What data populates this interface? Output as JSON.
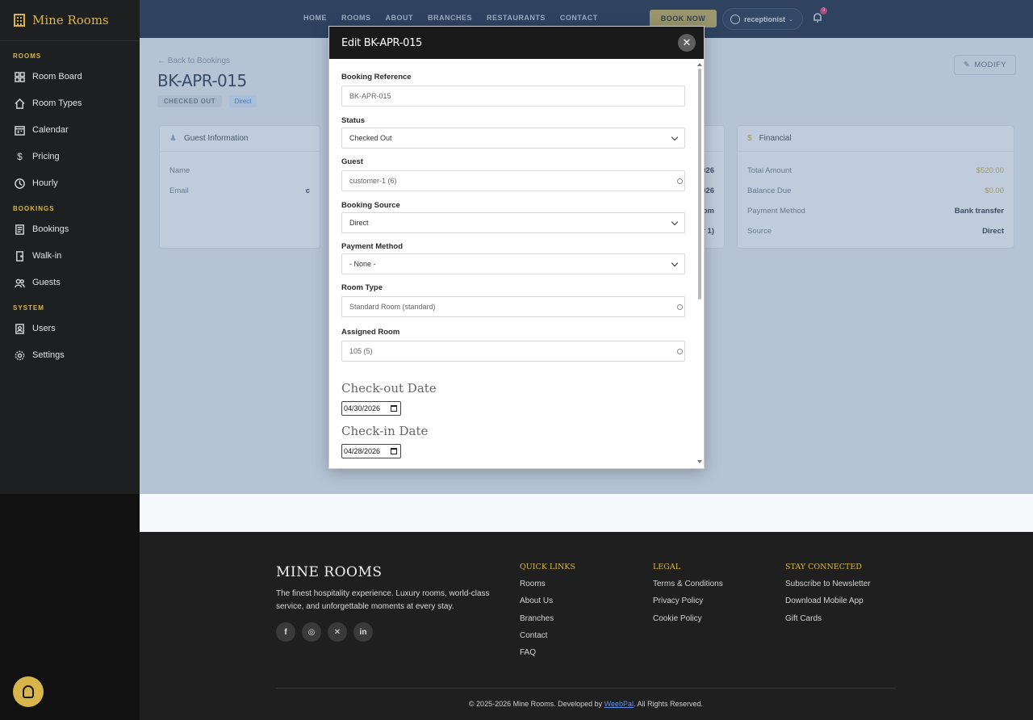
{
  "sidebar": {
    "brand": "Mine Rooms",
    "sections": [
      {
        "title": "ROOMS",
        "items": [
          "Room Board",
          "Room Types",
          "Calendar",
          "Pricing",
          "Hourly"
        ]
      },
      {
        "title": "BOOKINGS",
        "items": [
          "Bookings",
          "Walk-in",
          "Guests"
        ]
      },
      {
        "title": "SYSTEM",
        "items": [
          "Users",
          "Settings"
        ]
      }
    ]
  },
  "topnav": {
    "links": [
      "HOME",
      "ROOMS",
      "ABOUT",
      "BRANCHES",
      "RESTAURANTS",
      "CONTACT"
    ],
    "book_now": "BOOK NOW",
    "user": "receptionist",
    "notification_count": "3"
  },
  "booking": {
    "back_label": "← Back to Bookings",
    "reference": "BK-APR-015",
    "status_tag": "CHECKED OUT",
    "source_tag": "Direct",
    "modify_label": "MODIFY",
    "guest_card": {
      "title": "Guest Information",
      "rows": [
        {
          "label": "Name",
          "value": ""
        },
        {
          "label": "Email",
          "value": "c"
        }
      ]
    },
    "mid_card": {
      "values": [
        "026",
        "026",
        "om",
        "r 1)"
      ]
    },
    "financial_card": {
      "title": "Financial",
      "rows": [
        {
          "label": "Total Amount",
          "value": "$520.00"
        },
        {
          "label": "Balance Due",
          "value": "$0.00"
        },
        {
          "label": "Payment Method",
          "value": "Bank transfer"
        },
        {
          "label": "Source",
          "value": "Direct"
        }
      ]
    }
  },
  "modal": {
    "title": "Edit BK-APR-015",
    "fields": {
      "booking_reference": {
        "label": "Booking Reference",
        "value": "BK-APR-015"
      },
      "status": {
        "label": "Status",
        "value": "Checked Out"
      },
      "guest": {
        "label": "Guest",
        "value": "customer-1 (6)"
      },
      "booking_source": {
        "label": "Booking Source",
        "value": "Direct"
      },
      "payment_method": {
        "label": "Payment Method",
        "value": "- None -"
      },
      "room_type": {
        "label": "Room Type",
        "value": "Standard Room (standard)"
      },
      "assigned_room": {
        "label": "Assigned Room",
        "value": "105 (5)"
      },
      "check_out": {
        "label": "Check-out Date",
        "value": "04/30/2026"
      },
      "check_in": {
        "label": "Check-in Date",
        "value": "04/28/2026"
      }
    }
  },
  "footer": {
    "brand": "MINE ROOMS",
    "description": "The finest hospitality experience. Luxury rooms, world-class service, and unforgettable moments at every stay.",
    "columns": [
      {
        "title": "QUICK LINKS",
        "links": [
          "Rooms",
          "About Us",
          "Branches",
          "Contact",
          "FAQ"
        ]
      },
      {
        "title": "LEGAL",
        "links": [
          "Terms & Conditions",
          "Privacy Policy",
          "Cookie Policy"
        ]
      },
      {
        "title": "STAY CONNECTED",
        "links": [
          "Subscribe to Newsletter",
          "Download Mobile App",
          "Gift Cards"
        ]
      }
    ],
    "copyright_pre": "© 2025-2026 Mine Rooms. Developed by ",
    "copyright_link": "WeebPal",
    "copyright_post": ". All Rights Reserved."
  },
  "colors": {
    "accent": "#d8b54a",
    "topbar": "#15233a",
    "sidebar": "#1e1f21"
  }
}
